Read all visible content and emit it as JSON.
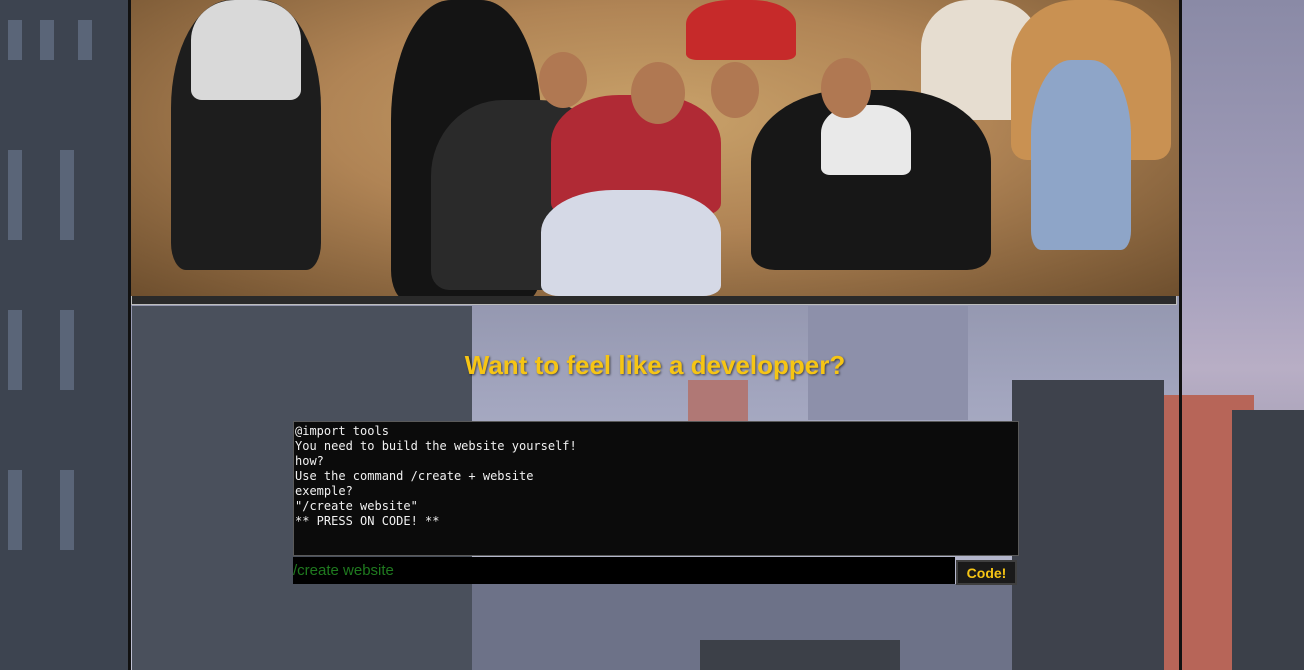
{
  "hero": {
    "image_alt": "Group photo of friends sitting on sand at night"
  },
  "headline": "Want to feel like a developper?",
  "terminal": {
    "lines": [
      "@import tools",
      "You need to build the website yourself!",
      "how?",
      "Use the command /create + website",
      "exemple?",
      "\"/create website\"",
      "** PRESS ON CODE! **"
    ]
  },
  "command": {
    "value": "/create website"
  },
  "code_button": {
    "label": "Code!"
  },
  "colors": {
    "accent": "#f6c514",
    "terminal_bg": "#0b0b0b",
    "input_text": "#1f7a1f"
  }
}
